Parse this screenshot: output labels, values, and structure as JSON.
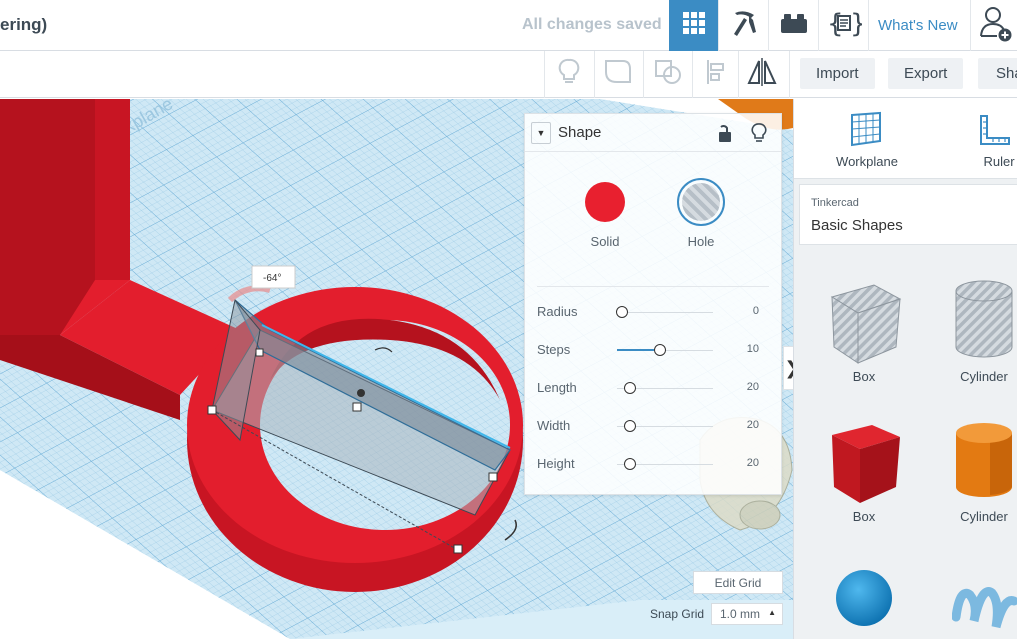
{
  "header": {
    "title": "ering)",
    "save_status": "All changes saved",
    "whats_new": "What's New"
  },
  "toolbar": {
    "import_label": "Import",
    "export_label": "Export",
    "share_label": "Sha"
  },
  "viewport": {
    "rotation_readout": "-64°",
    "workplane_text": "Workplane"
  },
  "shape_panel": {
    "title": "Shape",
    "solid_label": "Solid",
    "hole_label": "Hole",
    "solid_color": "#e8202f",
    "properties": [
      {
        "label": "Radius",
        "value": "0",
        "fraction": 0.0
      },
      {
        "label": "Steps",
        "value": "10",
        "fraction": 0.4
      },
      {
        "label": "Length",
        "value": "20",
        "fraction": 0.08
      },
      {
        "label": "Width",
        "value": "20",
        "fraction": 0.08
      },
      {
        "label": "Height",
        "value": "20",
        "fraction": 0.08
      }
    ]
  },
  "sidebar": {
    "workplane_label": "Workplane",
    "ruler_label": "Ruler",
    "library_category": "Tinkercad",
    "library_name": "Basic Shapes",
    "shapes": [
      {
        "label": "Box",
        "kind": "hole-box"
      },
      {
        "label": "Cylinder",
        "kind": "hole-cylinder"
      },
      {
        "label": "Box",
        "kind": "box"
      },
      {
        "label": "Cylinder",
        "kind": "cylinder"
      }
    ]
  },
  "grid_controls": {
    "edit_grid_label": "Edit Grid",
    "snap_grid_label": "Snap Grid",
    "snap_value": "1.0 mm"
  },
  "colors": {
    "accent": "#3b8cc4",
    "active_tool": "#3b8cc4",
    "shape_red": "#e8202f",
    "workplane": "#b9dcef"
  }
}
